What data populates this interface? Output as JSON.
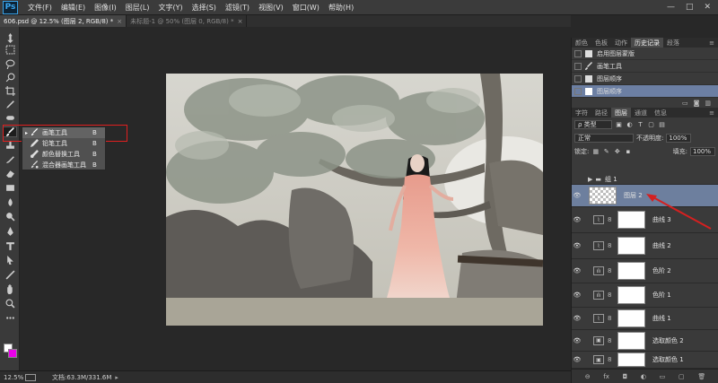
{
  "app": {
    "logo": "Ps"
  },
  "menu": [
    "文件(F)",
    "编辑(E)",
    "图像(I)",
    "图层(L)",
    "文字(Y)",
    "选择(S)",
    "滤镜(T)",
    "视图(V)",
    "窗口(W)",
    "帮助(H)"
  ],
  "window_controls": [
    "—",
    "□",
    "✕"
  ],
  "doc_tabs": [
    {
      "label": "606.psd @ 12.5% (图层 2, RGB/8) *",
      "close": "×"
    },
    {
      "label": "未标题-1 @ 50% (图层 0, RGB/8) *",
      "close": "×"
    }
  ],
  "flyout": {
    "items": [
      {
        "label": "画笔工具",
        "key": "B",
        "icon": "brush-icon"
      },
      {
        "label": "铅笔工具",
        "key": "B",
        "icon": "pencil-icon"
      },
      {
        "label": "颜色替换工具",
        "key": "B",
        "icon": "color-replace-icon"
      },
      {
        "label": "混合器画笔工具",
        "key": "B",
        "icon": "mixer-brush-icon"
      }
    ],
    "bullet": "▸"
  },
  "status": {
    "zoom": "12.5%",
    "doc_info": "文档:63.3M/331.6M",
    "arrow": "▸"
  },
  "history_panel": {
    "tabs": [
      "颜色",
      "色板",
      "动作",
      "历史记录",
      "段落"
    ],
    "active_tab": "历史记录",
    "menu": "≡",
    "items": [
      {
        "label": "启用图层蒙版",
        "icon": "doc-icon"
      },
      {
        "label": "画笔工具",
        "icon": "brush-icon"
      },
      {
        "label": "图层顺序",
        "icon": "doc-icon"
      },
      {
        "label": "图层顺序",
        "icon": "doc-icon",
        "selected": true
      }
    ]
  },
  "layers_panel": {
    "tabs": [
      "字符",
      "路径",
      "图层",
      "通道",
      "信息"
    ],
    "active_tab": "图层",
    "filter_label": "ρ 类型",
    "blend_mode": "正常",
    "opacity_label": "不透明度:",
    "opacity_value": "100%",
    "lock_label": "锁定:",
    "fill_label": "填充:",
    "fill_value": "100%",
    "group_name": "组 1",
    "eye": "👁",
    "chain": "8",
    "layers": [
      {
        "name": "图层 2",
        "type": "pixel",
        "selected": true
      },
      {
        "name": "曲线 3",
        "type": "curves",
        "adj_icon": "⌇"
      },
      {
        "name": "曲线 2",
        "type": "curves",
        "adj_icon": "⌇"
      },
      {
        "name": "色阶 2",
        "type": "levels",
        "adj_icon": "ılı"
      },
      {
        "name": "色阶 1",
        "type": "levels",
        "adj_icon": "ılı"
      },
      {
        "name": "曲线 1",
        "type": "curves",
        "adj_icon": "⌇"
      },
      {
        "name": "选取颜色 2",
        "type": "selective-color",
        "adj_icon": "▣"
      },
      {
        "name": "选取颜色 1",
        "type": "selective-color",
        "adj_icon": "▣"
      }
    ],
    "bottom_icons": [
      "⊖",
      "fx",
      "◘",
      "◐",
      "▭",
      "▢",
      "🗑"
    ]
  },
  "colors": {
    "foreground": "#ffffff",
    "background": "#e800e8",
    "selection": "#6d7f9e",
    "highlight": "#e02020"
  }
}
